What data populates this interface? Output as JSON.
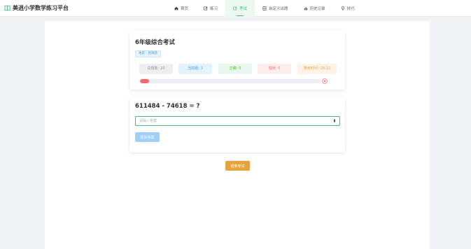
{
  "app": {
    "brand_name": "美逍小学数学练习平台",
    "brand_icon": "book-icon",
    "brand_color": "#42b983"
  },
  "nav": {
    "items": [
      {
        "label": "首页",
        "icon": "home-icon",
        "active": false
      },
      {
        "label": "练习",
        "icon": "edit-icon",
        "active": false
      },
      {
        "label": "考试",
        "icon": "exam-icon",
        "active": true
      },
      {
        "label": "自定义出题",
        "icon": "document-icon",
        "active": false
      },
      {
        "label": "历史记录",
        "icon": "bar-chart-icon",
        "active": false
      },
      {
        "label": "技巧",
        "icon": "bulb-icon",
        "active": false
      }
    ]
  },
  "exam": {
    "title": "6年级综合考试",
    "difficulty_tag": "难度：困难题",
    "stats": {
      "total_label": "总题数:",
      "total_value": "20",
      "current_label": "当前题:",
      "current_value": "1",
      "correct_label": "正确:",
      "correct_value": "0",
      "wrong_label": "错误:",
      "wrong_value": "0",
      "time_label": "剩余时间:",
      "time_value": "29:12"
    },
    "progress_percent": 5,
    "progress_color": "#f56c6c",
    "progress_status_icon": "close-circle-icon"
  },
  "question": {
    "text": "611484 - 74618 = ?",
    "input_placeholder": "请输入答案",
    "input_value": "",
    "submit_label": "提交答案"
  },
  "actions": {
    "finish_label": "结束考试"
  }
}
